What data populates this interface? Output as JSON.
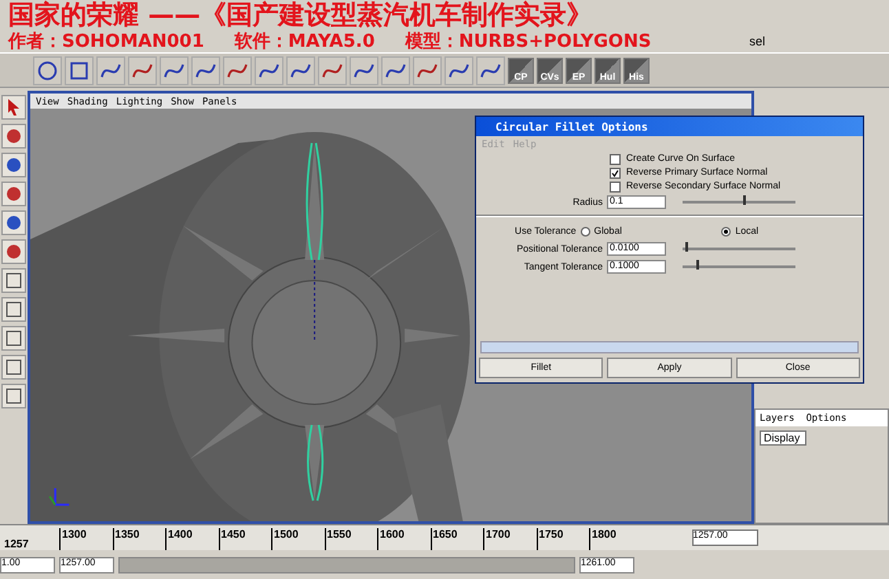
{
  "overlay": {
    "title": "国家的荣耀 ——《国产建设型蒸汽机车制作实录》",
    "credits": [
      "作者：SOHOMAN001",
      "软件：MAYA5.0",
      "模型：NURBS+POLYGONS"
    ]
  },
  "status_line": {
    "selection_label": "sel"
  },
  "shelf": {
    "labeled_buttons": [
      "CP",
      "CVs",
      "EP",
      "Hul",
      "His"
    ]
  },
  "viewport": {
    "menu": [
      "View",
      "Shading",
      "Lighting",
      "Show",
      "Panels"
    ]
  },
  "dialog": {
    "title": "Circular Fillet Options",
    "menu": [
      "Edit",
      "Help"
    ],
    "options": [
      {
        "label": "Create Curve On Surface",
        "checked": false
      },
      {
        "label": "Reverse Primary Surface Normal",
        "checked": true
      },
      {
        "label": "Reverse Secondary Surface Normal",
        "checked": false
      }
    ],
    "radius": {
      "label": "Radius",
      "value": "0.1",
      "level": 0.55
    },
    "use_tolerance": {
      "label": "Use Tolerance",
      "options": [
        {
          "label": "Global",
          "selected": false
        },
        {
          "label": "Local",
          "selected": true
        }
      ]
    },
    "tolerances": [
      {
        "label": "Positional Tolerance",
        "value": "0.0100",
        "level": 0.03
      },
      {
        "label": "Tangent Tolerance",
        "value": "0.1000",
        "level": 0.12
      }
    ],
    "buttons": [
      "Fillet",
      "Apply",
      "Close"
    ]
  },
  "layers": {
    "menu": "Layers  Options",
    "display": "Display"
  },
  "timeline": {
    "start_label": "1257",
    "ticks": [
      "1300",
      "1350",
      "1400",
      "1450",
      "1500",
      "1550",
      "1600",
      "1650",
      "1700",
      "1750",
      "1800"
    ],
    "current_time": "1257.00"
  },
  "range": {
    "start": "1.00",
    "playback_start": "1257.00",
    "playback_end": "1261.00"
  }
}
